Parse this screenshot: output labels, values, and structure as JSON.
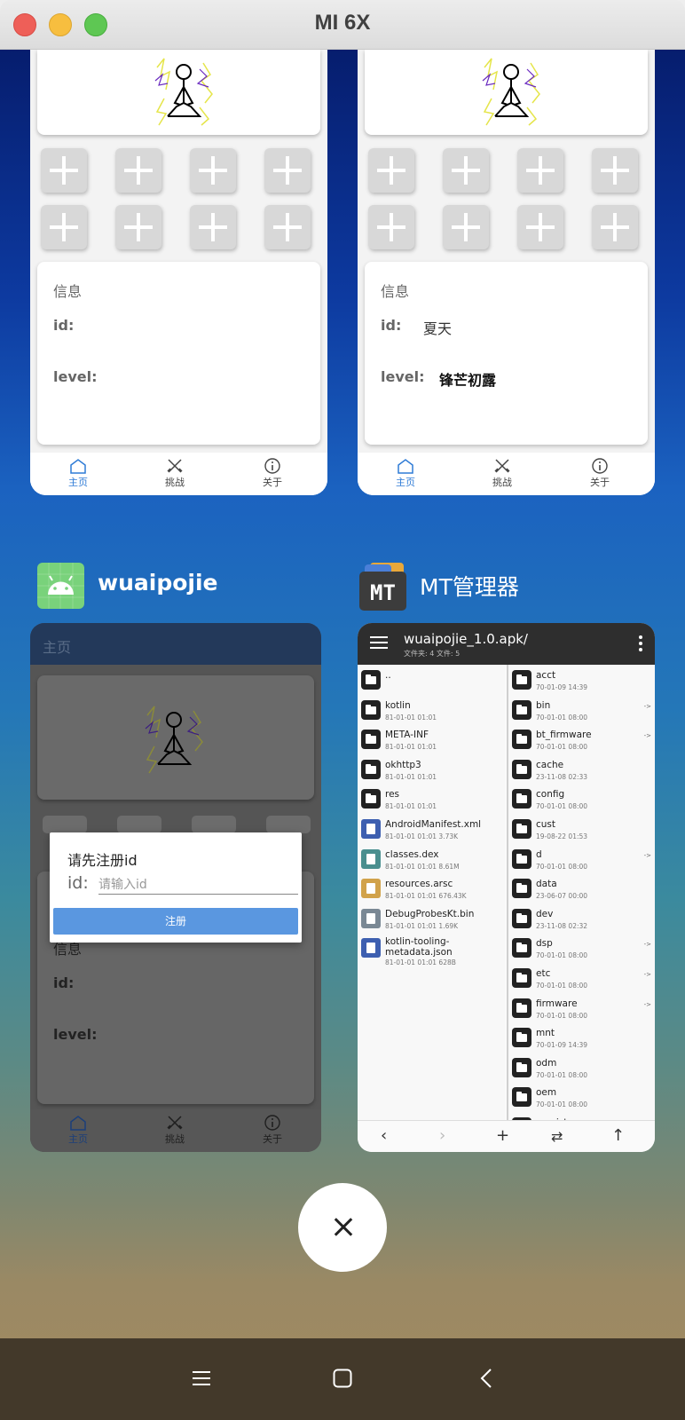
{
  "window": {
    "title": "MI 6X"
  },
  "cards_top": [
    {
      "info_title": "信息",
      "id_label": "id:",
      "id_value": "",
      "level_label": "level:",
      "level_value": "",
      "nav": {
        "home": "主页",
        "challenge": "挑战",
        "about": "关于"
      }
    },
    {
      "info_title": "信息",
      "id_label": "id:",
      "id_value": "夏天",
      "level_label": "level:",
      "level_value": "锋芒初露",
      "nav": {
        "home": "主页",
        "challenge": "挑战",
        "about": "关于"
      }
    }
  ],
  "apps": {
    "wuaipojie": {
      "name": "wuaipojie",
      "appbar_title": "主页",
      "info_title": "信息",
      "id_label": "id:",
      "level_label": "level:",
      "nav": {
        "home": "主页",
        "challenge": "挑战",
        "about": "关于"
      },
      "dialog": {
        "title": "请先注册id",
        "label": "id:",
        "placeholder": "请输入id",
        "button": "注册"
      }
    },
    "mt": {
      "name": "MT管理器",
      "icon_text": "MT",
      "path": "wuaipojie_1.0.apk/",
      "subtitle": "文件夹: 4  文件: 5",
      "left_files": [
        {
          "name": "..",
          "meta": "",
          "icon": "folder"
        },
        {
          "name": "kotlin",
          "meta": "81-01-01 01:01",
          "icon": "folder"
        },
        {
          "name": "META-INF",
          "meta": "81-01-01 01:01",
          "icon": "folder"
        },
        {
          "name": "okhttp3",
          "meta": "81-01-01 01:01",
          "icon": "folder"
        },
        {
          "name": "res",
          "meta": "81-01-01 01:01",
          "icon": "folder"
        },
        {
          "name": "AndroidManifest.xml",
          "meta": "81-01-01 01:01  3.73K",
          "icon": "xml"
        },
        {
          "name": "classes.dex",
          "meta": "81-01-01 01:01  8.61M",
          "icon": "dex"
        },
        {
          "name": "resources.arsc",
          "meta": "81-01-01 01:01  676.43K",
          "icon": "arsc"
        },
        {
          "name": "DebugProbesKt.bin",
          "meta": "81-01-01 01:01  1.69K",
          "icon": "bin"
        },
        {
          "name": "kotlin-tooling-metadata.json",
          "meta": "81-01-01 01:01  628B",
          "icon": "json"
        }
      ],
      "right_files": [
        {
          "name": "acct",
          "meta": "70-01-09 14:39",
          "link": false
        },
        {
          "name": "bin",
          "meta": "70-01-01 08:00",
          "link": true
        },
        {
          "name": "bt_firmware",
          "meta": "70-01-01 08:00",
          "link": true
        },
        {
          "name": "cache",
          "meta": "23-11-08 02:33",
          "link": false
        },
        {
          "name": "config",
          "meta": "70-01-01 08:00",
          "link": false
        },
        {
          "name": "cust",
          "meta": "19-08-22 01:53",
          "link": false
        },
        {
          "name": "d",
          "meta": "70-01-01 08:00",
          "link": true
        },
        {
          "name": "data",
          "meta": "23-06-07 00:00",
          "link": false
        },
        {
          "name": "dev",
          "meta": "23-11-08 02:32",
          "link": false
        },
        {
          "name": "dsp",
          "meta": "70-01-01 08:00",
          "link": true
        },
        {
          "name": "etc",
          "meta": "70-01-01 08:00",
          "link": true
        },
        {
          "name": "firmware",
          "meta": "70-01-01 08:00",
          "link": true
        },
        {
          "name": "mnt",
          "meta": "70-01-09 14:39",
          "link": false
        },
        {
          "name": "odm",
          "meta": "70-01-01 08:00",
          "link": false
        },
        {
          "name": "oem",
          "meta": "70-01-01 08:00",
          "link": false
        },
        {
          "name": "persist",
          "meta": "",
          "link": false
        }
      ],
      "link_arrow": "->",
      "toolbar": [
        "back-icon",
        "forward-icon",
        "add-icon",
        "swap-icon",
        "up-icon"
      ]
    }
  },
  "icons": {
    "close": "close-icon",
    "system_nav": [
      "menu-icon",
      "home-square-icon",
      "back-chevron-icon"
    ]
  }
}
